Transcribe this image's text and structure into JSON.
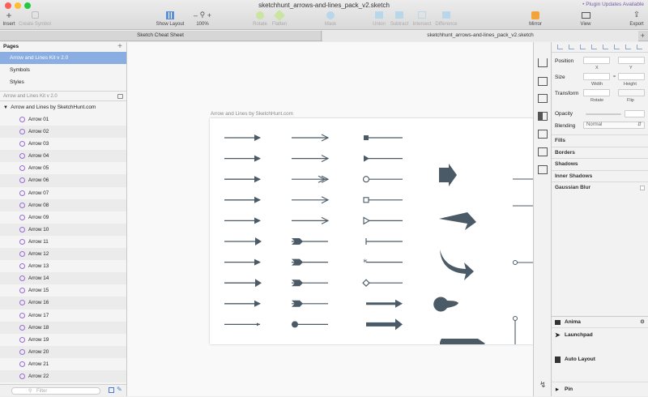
{
  "window": {
    "title": "sketchhunt_arrows-and-lines_pack_v2.sketch",
    "plugin_badge": "• Plugin Updates Available"
  },
  "toolbar": {
    "insert": "Insert",
    "create_symbol": "Create Symbol",
    "show_layout": "Show Layout",
    "zoom": "100%",
    "rotate": "Rotate",
    "flatten": "Flatten",
    "mask": "Mask",
    "union": "Union",
    "subtract": "Subtract",
    "intersect": "Intersect",
    "difference": "Difference",
    "mirror": "Mirror",
    "view": "View",
    "export": "Export"
  },
  "tabs": [
    "Sketch Cheat Sheet",
    "sketchhunt_arrows-and-lines_pack_v2.sketch"
  ],
  "sidebar": {
    "pages_title": "Pages",
    "pages": [
      "Arrow and Lines Kit v 2.0",
      "Symbols",
      "Styles"
    ],
    "selected_page": "Arrow and Lines Kit v 2.0",
    "layers_header": "Arrow and Lines Kit v 2.0",
    "group": "Arrow and Lines by SketchHunt.com",
    "layers": [
      "Arrow 01",
      "Arrow 02",
      "Arrow 03",
      "Arrow 04",
      "Arrow 05",
      "Arrow 06",
      "Arrow 07",
      "Arrow 08",
      "Arrow 09",
      "Arrow 10",
      "Arrow 11",
      "Arrow 12",
      "Arrow 13",
      "Arrow 14",
      "Arrow 15",
      "Arrow 16",
      "Arrow 17",
      "Arrow 18",
      "Arrow 19",
      "Arrow 20",
      "Arrow 21",
      "Arrow 22"
    ],
    "filter_placeholder": "Filter"
  },
  "canvas": {
    "artboard_title": "Arrow and Lines by SketchHunt.com",
    "arrow_color": "#4a5a66"
  },
  "inspector": {
    "position": "Position",
    "x": "X",
    "y": "Y",
    "size": "Size",
    "width": "Width",
    "height": "Height",
    "transform": "Transform",
    "rotate": "Rotate",
    "flip": "Flip",
    "opacity": "Opacity",
    "blending": "Blending",
    "blending_value": "Normal",
    "sections": [
      "Fills",
      "Borders",
      "Shadows",
      "Inner Shadows",
      "Gaussian Blur"
    ]
  },
  "anima": {
    "title": "Anima",
    "launchpad": "Launchpad",
    "auto_layout": "Auto Layout",
    "pin": "Pin"
  }
}
